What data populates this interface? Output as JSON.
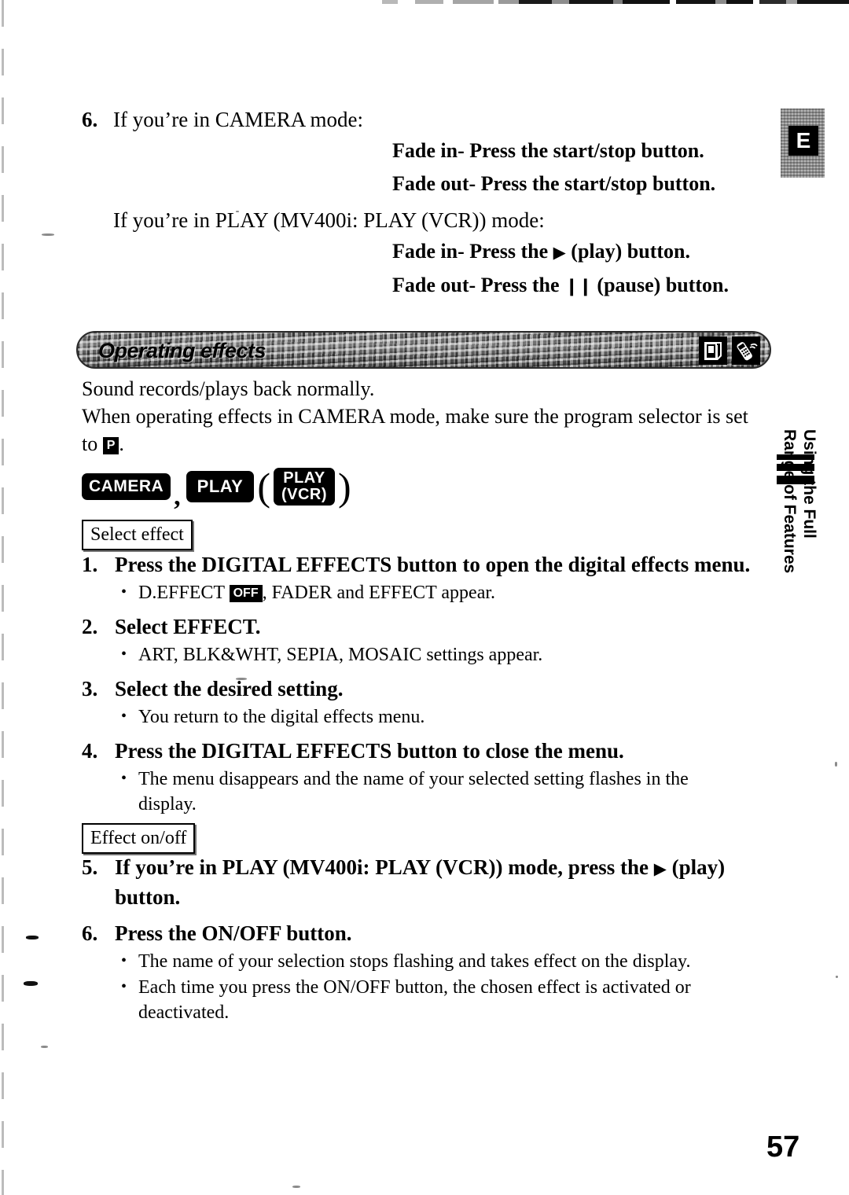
{
  "page": {
    "number": "57",
    "side_tab_line1": "Using the Full",
    "side_tab_line2": "Range of Features",
    "edition_badge": "E"
  },
  "top_step": {
    "number": "6.",
    "intro": "If you’re in CAMERA mode:",
    "camera_fade_in": "Fade in- Press the start/stop button.",
    "camera_fade_out": "Fade out- Press the start/stop button.",
    "play_intro": "If you’re in PLAY (MV400i: PLAY (VCR)) mode:",
    "play_fade_in_before": "Fade in- Press the ",
    "play_fade_in_glyph": "▶",
    "play_fade_in_after": " (play) button.",
    "play_fade_out_before": "Fade out- Press the ",
    "play_fade_out_glyph": "❙❙",
    "play_fade_out_after": " (pause) button."
  },
  "section": {
    "title": "Operating effects",
    "icons": [
      "tape-icon",
      "remote-control-icon"
    ],
    "intro_line1": "Sound records/plays back normally.",
    "intro_line2": "When operating effects in CAMERA mode, make sure the program selector is set",
    "intro_line3_before": "to ",
    "intro_line3_badge": "P",
    "intro_line3_after": "."
  },
  "mode_badges": {
    "camera": "CAMERA",
    "separator": ",",
    "play": "PLAY",
    "paren_open": "(",
    "play_vcr_line1": "PLAY",
    "play_vcr_line2": "(VCR)",
    "paren_close": ")"
  },
  "labels": {
    "select_effect": "Select effect",
    "effect_on_off": "Effect on/off"
  },
  "procedure_select": [
    {
      "num": "1.",
      "head": "Press the DIGITAL EFFECTS button to open the digital effects menu.",
      "bullets_pre": "D.EFFECT ",
      "bullets_badge": "OFF",
      "bullets_post": ", FADER and EFFECT appear."
    },
    {
      "num": "2.",
      "head": "Select EFFECT.",
      "bullet": "ART, BLK&WHT, SEPIA, MOSAIC settings appear."
    },
    {
      "num": "3.",
      "head": "Select the desired setting.",
      "bullet": "You return to the digital effects menu."
    },
    {
      "num": "4.",
      "head": "Press the DIGITAL EFFECTS button to close the menu.",
      "bullet": "The menu disappears and the name of your selected setting flashes in the display."
    }
  ],
  "procedure_onoff": [
    {
      "num": "5.",
      "head_before": "If you’re in PLAY (MV400i: PLAY (VCR)) mode, press the ",
      "head_glyph": "▶",
      "head_after": " (play) button."
    },
    {
      "num": "6.",
      "head": "Press the ON/OFF button.",
      "bullet1": "The name of your selection stops flashing and takes effect on the display.",
      "bullet2": "Each time you press the ON/OFF button, the chosen effect is activated or deactivated."
    }
  ]
}
